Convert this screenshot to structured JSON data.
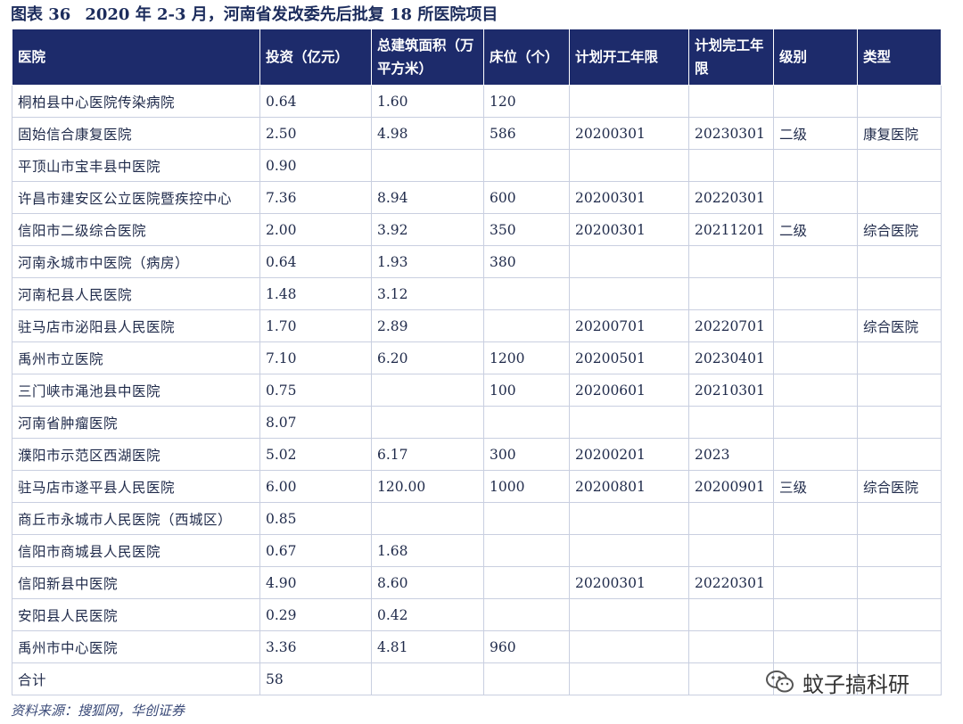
{
  "caption": {
    "label": "图表 36",
    "title": "2020 年 2-3 月，河南省发改委先后批复 18 所医院项目"
  },
  "table": {
    "headers": [
      "医院",
      "投资（亿元）",
      "总建筑面积（万平方米）",
      "床位（个）",
      "计划开工年限",
      "计划完工年限",
      "级别",
      "类型"
    ],
    "rows": [
      [
        "桐柏县中心医院传染病院",
        "0.64",
        "1.60",
        "120",
        "",
        "",
        "",
        ""
      ],
      [
        "固始信合康复医院",
        "2.50",
        "4.98",
        "586",
        "20200301",
        "20230301",
        "二级",
        "康复医院"
      ],
      [
        "平顶山市宝丰县中医院",
        "0.90",
        "",
        "",
        "",
        "",
        "",
        ""
      ],
      [
        "许昌市建安区公立医院暨疾控中心",
        "7.36",
        "8.94",
        "600",
        "20200301",
        "20220301",
        "",
        ""
      ],
      [
        "信阳市二级综合医院",
        "2.00",
        "3.92",
        "350",
        "20200301",
        "20211201",
        "二级",
        "综合医院"
      ],
      [
        "河南永城市中医院（病房）",
        "0.64",
        "1.93",
        "380",
        "",
        "",
        "",
        ""
      ],
      [
        "河南杞县人民医院",
        "1.48",
        "3.12",
        "",
        "",
        "",
        "",
        ""
      ],
      [
        "驻马店市泌阳县人民医院",
        "1.70",
        "2.89",
        "",
        "20200701",
        "20220701",
        "",
        "综合医院"
      ],
      [
        "禹州市立医院",
        "7.10",
        "6.20",
        "1200",
        "20200501",
        "20230401",
        "",
        ""
      ],
      [
        "三门峡市渑池县中医院",
        "0.75",
        "",
        "100",
        "20200601",
        "20210301",
        "",
        ""
      ],
      [
        "河南省肿瘤医院",
        "8.07",
        "",
        "",
        "",
        "",
        "",
        ""
      ],
      [
        "濮阳市示范区西湖医院",
        "5.02",
        "6.17",
        "300",
        "20200201",
        "2023",
        "",
        ""
      ],
      [
        "驻马店市遂平县人民医院",
        "6.00",
        "120.00",
        "1000",
        "20200801",
        "20200901",
        "三级",
        "综合医院"
      ],
      [
        "商丘市永城市人民医院（西城区）",
        "0.85",
        "",
        "",
        "",
        "",
        "",
        ""
      ],
      [
        "信阳市商城县人民医院",
        "0.67",
        "1.68",
        "",
        "",
        "",
        "",
        ""
      ],
      [
        "信阳新县中医院",
        "4.90",
        "8.60",
        "",
        "20200301",
        "20220301",
        "",
        ""
      ],
      [
        "安阳县人民医院",
        "0.29",
        "0.42",
        "",
        "",
        "",
        "",
        ""
      ],
      [
        "禹州市中心医院",
        "3.36",
        "4.81",
        "960",
        "",
        "",
        "",
        ""
      ],
      [
        "合计",
        "58",
        "",
        "",
        "",
        "",
        "",
        ""
      ]
    ]
  },
  "source": "资料来源：搜狐网，华创证券",
  "watermark": {
    "text": "蚊子搞科研",
    "icon": "wechat-icon"
  }
}
